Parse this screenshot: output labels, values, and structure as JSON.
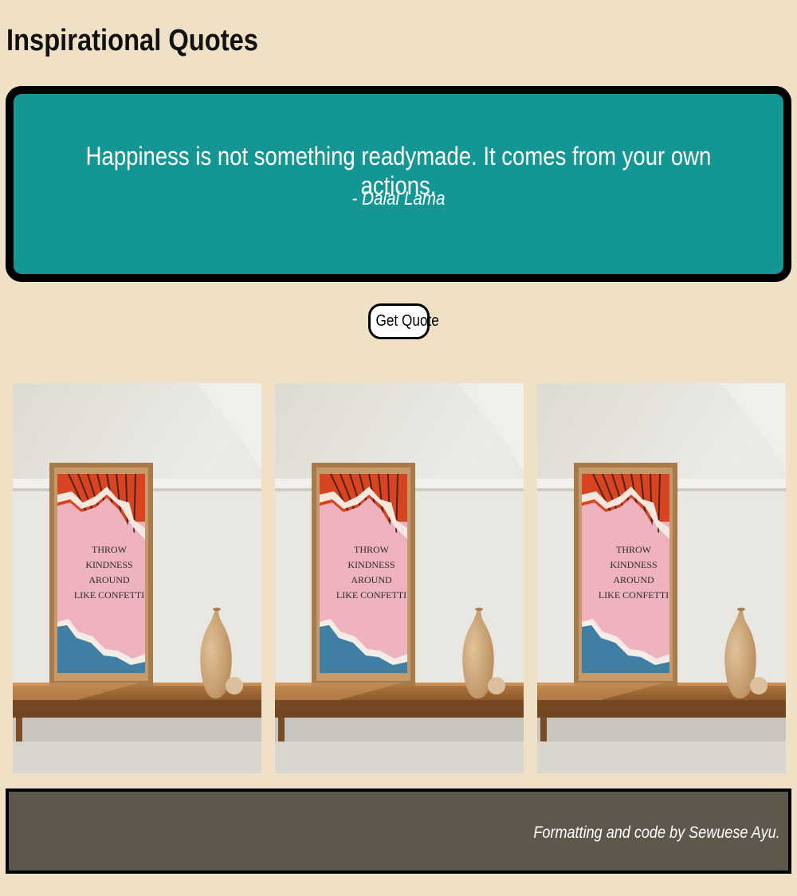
{
  "page": {
    "title": "Inspirational Quotes"
  },
  "quote": {
    "text": "Happiness is not something readymade. It comes from your own actions.",
    "author": "- Dalai Lama"
  },
  "controls": {
    "get_quote_label": "Get Quote"
  },
  "gallery": {
    "images": [
      {
        "poster_lines": [
          "THROW",
          "KINDNESS",
          "AROUND",
          "LIKE CONFETTI"
        ]
      },
      {
        "poster_lines": [
          "THROW",
          "KINDNESS",
          "AROUND",
          "LIKE CONFETTI"
        ]
      },
      {
        "poster_lines": [
          "THROW",
          "KINDNESS",
          "AROUND",
          "LIKE CONFETTI"
        ]
      }
    ]
  },
  "footer": {
    "credit": "Formatting and code by Sewuese Ayu."
  },
  "colors": {
    "background": "#efe0c6",
    "quote_box": "#149794",
    "footer": "#5d574c"
  }
}
